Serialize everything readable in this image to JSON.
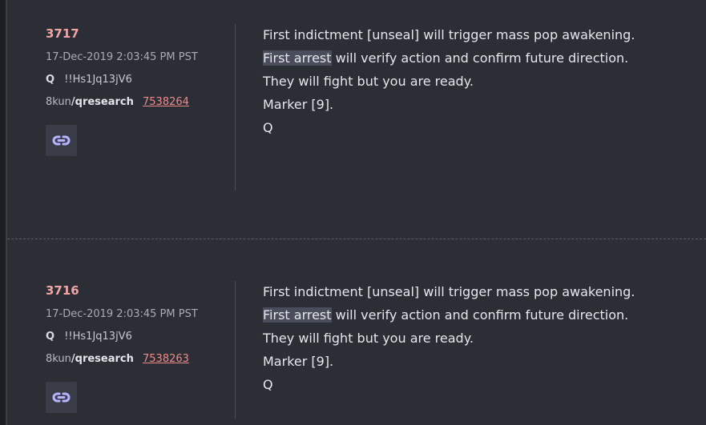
{
  "posts": [
    {
      "number": "3717",
      "date": "17-Dec-2019 2:03:45 PM PST",
      "author": "Q",
      "tripcode": "!!Hs1Jq13jV6",
      "site": "8kun",
      "separator": "/",
      "board": "qresearch",
      "post_id": "7538264",
      "link_icon": "link-icon",
      "lines": {
        "l1": "First indictment [unseal] will trigger mass pop awakening.",
        "l2_highlight": "First arrest",
        "l2_rest": " will verify action and confirm future direction.",
        "l3": "They will fight but you are ready.",
        "l4": "Marker [9].",
        "l5": "Q"
      }
    },
    {
      "number": "3716",
      "date": "17-Dec-2019 2:03:45 PM PST",
      "author": "Q",
      "tripcode": "!!Hs1Jq13jV6",
      "site": "8kun",
      "separator": "/",
      "board": "qresearch",
      "post_id": "7538263",
      "link_icon": "link-icon",
      "lines": {
        "l1": "First indictment [unseal] will trigger mass pop awakening.",
        "l2_highlight": "First arrest",
        "l2_rest": " will verify action and confirm future direction.",
        "l3": "They will fight but you are ready.",
        "l4": "Marker [9].",
        "l5": "Q"
      }
    }
  ],
  "colors": {
    "background": "#2c2e36",
    "post_number": "#f2a5a5",
    "post_link": "#f08a8a",
    "highlight": "#4a4d5c",
    "link_icon": "#b6b3ff"
  }
}
